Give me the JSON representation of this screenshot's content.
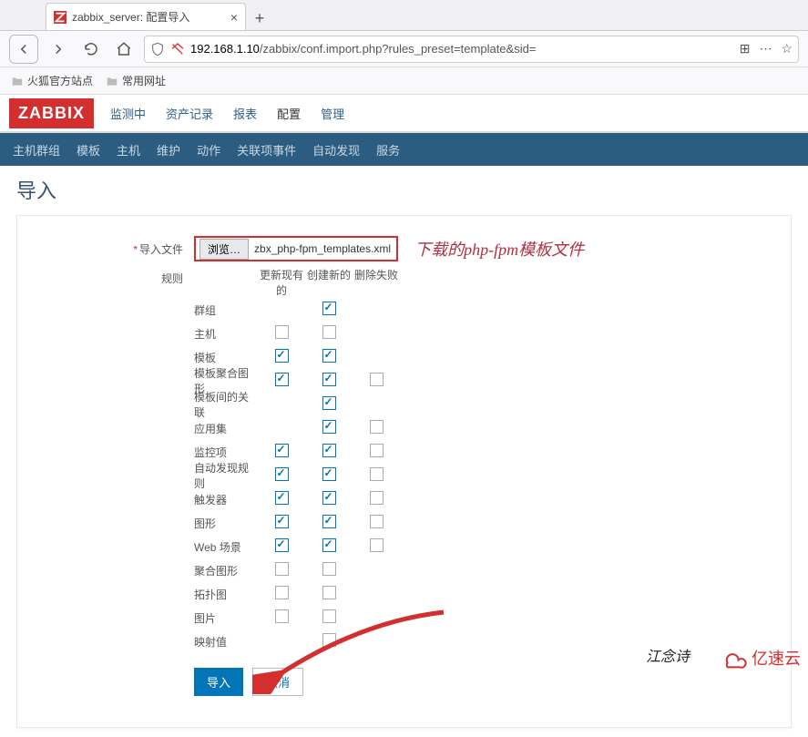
{
  "browser": {
    "tab_title": "zabbix_server: 配置导入",
    "url_host": "192.168.1.10",
    "url_path": "/zabbix/conf.import.php?rules_preset=template&sid=",
    "bookmarks": [
      "火狐官方站点",
      "常用网址"
    ]
  },
  "zabbix": {
    "logo": "ZABBIX",
    "top_menu": [
      "监测中",
      "资产记录",
      "报表",
      "配置",
      "管理"
    ],
    "top_menu_active_index": 3,
    "sub_menu": [
      "主机群组",
      "模板",
      "主机",
      "维护",
      "动作",
      "关联项事件",
      "自动发现",
      "服务"
    ],
    "page_title": "导入"
  },
  "form": {
    "file_label": "导入文件",
    "browse_label": "浏览…",
    "file_name": "zbx_php-fpm_templates.xml",
    "annotation": "下载的php-fpm模板文件",
    "rules_label": "规则",
    "headers": [
      "更新现有的",
      "创建新的",
      "删除失败"
    ],
    "rows": [
      {
        "label": "群组",
        "cols": [
          null,
          true,
          null
        ]
      },
      {
        "label": "主机",
        "cols": [
          false,
          false,
          null
        ]
      },
      {
        "label": "模板",
        "cols": [
          true,
          true,
          null
        ]
      },
      {
        "label": "模板聚合图形",
        "cols": [
          true,
          true,
          false
        ]
      },
      {
        "label": "模板间的关联",
        "cols": [
          null,
          true,
          null
        ]
      },
      {
        "label": "应用集",
        "cols": [
          null,
          true,
          false
        ]
      },
      {
        "label": "监控项",
        "cols": [
          true,
          true,
          false
        ]
      },
      {
        "label": "自动发现规则",
        "cols": [
          true,
          true,
          false
        ]
      },
      {
        "label": "触发器",
        "cols": [
          true,
          true,
          false
        ]
      },
      {
        "label": "图形",
        "cols": [
          true,
          true,
          false
        ]
      },
      {
        "label": "Web 场景",
        "cols": [
          true,
          true,
          false
        ]
      },
      {
        "label": "聚合图形",
        "cols": [
          false,
          false,
          null
        ]
      },
      {
        "label": "拓扑图",
        "cols": [
          false,
          false,
          null
        ]
      },
      {
        "label": "图片",
        "cols": [
          false,
          false,
          null
        ]
      },
      {
        "label": "映射值",
        "cols": [
          null,
          false,
          null
        ]
      }
    ],
    "submit_label": "导入",
    "cancel_label": "取消"
  },
  "watermark1": "江念诗",
  "watermark2": "亿速云"
}
